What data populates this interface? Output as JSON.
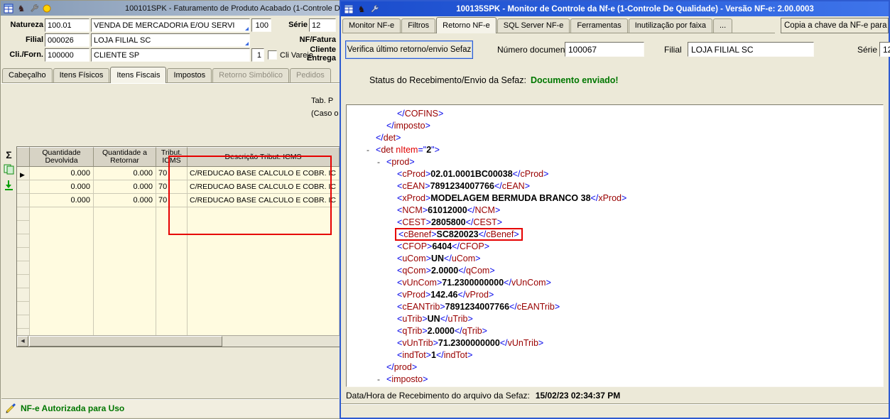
{
  "icons": {
    "sum": "Σ",
    "row_marker": "▶",
    "scroll_left": "◀",
    "knight": "♞",
    "collapse": "-"
  },
  "colors": {
    "status_green": "#007700",
    "annotation_red": "#e60000",
    "active_titlebar_blue": "#2e5bd0"
  },
  "left_window": {
    "title": "100101SPK - Faturamento de Produto Acabado (1-Controle D",
    "form": {
      "natureza_label": "Natureza",
      "natureza_code": "100.01",
      "natureza_desc": "VENDA DE MERCADORIA E/OU SERVI",
      "natureza_extra": "100",
      "serie_label": "Série",
      "serie_value": "12",
      "filial_label": "Filial",
      "filial_code": "000026",
      "filial_desc": "LOJA FILIAL SC",
      "nf_fatura_label": "NF/Fatura",
      "cli_forn_label": "Cli./Forn.",
      "cli_forn_code": "100000",
      "cli_forn_desc": "CLIENTE SP",
      "cli_forn_extra": "1",
      "cli_varejo_label": "Cli Varejo",
      "cliente_entrega_line1": "Cliente",
      "cliente_entrega_line2": "Entrega"
    },
    "tabs": [
      {
        "label": "Cabeçalho",
        "state": "normal"
      },
      {
        "label": "Itens Físicos",
        "state": "normal"
      },
      {
        "label": "Itens Fiscais",
        "state": "active"
      },
      {
        "label": "Impostos",
        "state": "normal"
      },
      {
        "label": "Retorno Simbólico",
        "state": "disabled"
      },
      {
        "label": "Pedidos",
        "state": "disabled"
      }
    ],
    "panel_text_1": "Tab. P",
    "panel_text_2": "(Caso o",
    "grid": {
      "columns": [
        "",
        "Quantidade Devolvida",
        "Quantidade a Retornar",
        "Tribut. ICMS",
        "Descrição Tribut. ICMS"
      ],
      "rows": [
        [
          "0.000",
          "0.000",
          "70",
          "C/REDUCAO BASE CALCULO E COBR. IC"
        ],
        [
          "0.000",
          "0.000",
          "70",
          "C/REDUCAO BASE CALCULO E COBR. IC"
        ],
        [
          "0.000",
          "0.000",
          "70",
          "C/REDUCAO BASE CALCULO E COBR. IC"
        ]
      ]
    },
    "status_text": "NF-e Autorizada para Uso"
  },
  "right_window": {
    "title": "100135SPK - Monitor de Controle da Nf-e (1-Controle De Qualidade) - Versão NF-e: 2.00.0003",
    "tabs": [
      {
        "label": "Monitor NF-e",
        "state": "normal"
      },
      {
        "label": "Filtros",
        "state": "normal"
      },
      {
        "label": "Retorno NF-e",
        "state": "active"
      },
      {
        "label": "SQL Server NF-e",
        "state": "normal"
      },
      {
        "label": "Ferramentas",
        "state": "normal"
      },
      {
        "label": "Inutilização por faixa",
        "state": "normal"
      },
      {
        "label": "...",
        "state": "normal"
      }
    ],
    "copy_key_button": "Copia a chave da NF-e para",
    "verify_button": "Verifica último retorno/envio Sefaz",
    "numero_documento_label": "Número documento",
    "numero_documento_value": "100067",
    "filial_label": "Filial",
    "filial_value": "LOJA FILIAL SC",
    "serie_label": "Série",
    "serie_value": "12",
    "status_label": "Status do Recebimento/Envio da Sefaz:",
    "status_value": "Documento enviado!",
    "xml_lines": [
      {
        "ind": 3,
        "type": "close",
        "name": "COFINS"
      },
      {
        "ind": 2,
        "type": "close",
        "name": "imposto"
      },
      {
        "ind": 1,
        "type": "close",
        "name": "det"
      },
      {
        "ind": 1,
        "type": "open",
        "name": "det",
        "attr_name": "nItem",
        "attr_value": "2",
        "marker": true
      },
      {
        "ind": 2,
        "type": "open",
        "name": "prod",
        "marker": true
      },
      {
        "ind": 3,
        "type": "elem",
        "name": "cProd",
        "value": "02.01.0001BC00038"
      },
      {
        "ind": 3,
        "type": "elem",
        "name": "cEAN",
        "value": "7891234007766"
      },
      {
        "ind": 3,
        "type": "elem",
        "name": "xProd",
        "value": "MODELAGEM BERMUDA BRANCO 38"
      },
      {
        "ind": 3,
        "type": "elem",
        "name": "NCM",
        "value": "61012000"
      },
      {
        "ind": 3,
        "type": "elem",
        "name": "CEST",
        "value": "2805800"
      },
      {
        "ind": 3,
        "type": "elem",
        "name": "cBenef",
        "value": "SC820023",
        "highlight": true
      },
      {
        "ind": 3,
        "type": "elem",
        "name": "CFOP",
        "value": "6404"
      },
      {
        "ind": 3,
        "type": "elem",
        "name": "uCom",
        "value": "UN"
      },
      {
        "ind": 3,
        "type": "elem",
        "name": "qCom",
        "value": "2.0000"
      },
      {
        "ind": 3,
        "type": "elem",
        "name": "vUnCom",
        "value": "71.2300000000"
      },
      {
        "ind": 3,
        "type": "elem",
        "name": "vProd",
        "value": "142.46"
      },
      {
        "ind": 3,
        "type": "elem",
        "name": "cEANTrib",
        "value": "7891234007766"
      },
      {
        "ind": 3,
        "type": "elem",
        "name": "uTrib",
        "value": "UN"
      },
      {
        "ind": 3,
        "type": "elem",
        "name": "qTrib",
        "value": "2.0000"
      },
      {
        "ind": 3,
        "type": "elem",
        "name": "vUnTrib",
        "value": "71.2300000000"
      },
      {
        "ind": 3,
        "type": "elem",
        "name": "indTot",
        "value": "1"
      },
      {
        "ind": 2,
        "type": "close",
        "name": "prod"
      },
      {
        "ind": 2,
        "type": "open",
        "name": "imposto",
        "marker": true
      }
    ],
    "datetime_label": "Data/Hora de Recebimento do arquivo da Sefaz:",
    "datetime_value": "15/02/23 02:34:37 PM"
  }
}
